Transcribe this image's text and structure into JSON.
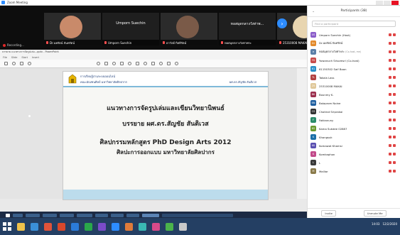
{
  "window": {
    "title": "Zoom Meeting"
  },
  "recording": {
    "label": "Recording..."
  },
  "video_tiles": [
    {
      "name": "Dr.นพรัตน์ จันทรัตน์",
      "kind": "video",
      "face_color": "#c98a6a"
    },
    {
      "name": "Umporn Suechin",
      "kind": "name",
      "display": "Umporn Suechin"
    },
    {
      "name": "ดาวัลย์ กิตติรัตน์",
      "kind": "video",
      "face_color": "#7a5a48"
    },
    {
      "name": "หอสมุดกลางวังท่าพระ",
      "kind": "name",
      "display": "หอสมุดกลางวังท่าพ..."
    },
    {
      "name": "25310008 MAKAI",
      "kind": "video",
      "face_color": "#e8d5b0"
    }
  ],
  "ppt": {
    "title": "บรรยาย แนวทางการจัดรูปเล่ม...pptx - PowerPoint",
    "tabs": [
      "File",
      "Slide",
      "Start",
      "Insert"
    ],
    "slide": {
      "header_line1": "การเรียนรู้ผ่านระบบออนไลน์",
      "header_line2": "คณะมัณฑนศิลป์ มหาวิทยาลัยศิลปากร",
      "header_right": "ผศ.ดร.สัญชัย สันติเวส",
      "lines": [
        "แนวทางการจัดรูปเล่มและเขียนวิทยานิพนธ์",
        "บรรยาย ผศ.ดร.สัญชัย สันติเวส",
        "ศิลปกรรมหลักสูตร PhD Design Arts 2012",
        "ศิลปะการออกแบบ มหาวิทยาลัยศิลปากร"
      ]
    }
  },
  "participants": {
    "title": "Participants (38)",
    "search_placeholder": "Find a participant",
    "list": [
      {
        "name": "Umporn Suechin (Host)",
        "tag": "",
        "color": "#8a5cc9",
        "initials": "US"
      },
      {
        "name": "Dr.นพรัตน์ จันทรัตน์",
        "tag": "",
        "color": "#e38a2b",
        "initials": "Dr"
      },
      {
        "name": "หอสมุดกลางวังท่าพระ",
        "tag": "(Co-host, me)",
        "color": "#5b7fa8",
        "initials": "ห"
      },
      {
        "name": "Yuwanuch Srisomsri (Co-host)",
        "tag": "",
        "color": "#c74b4b",
        "initials": "YS"
      },
      {
        "name": "61150302 Saif Boon",
        "tag": "",
        "color": "#2a8fc9",
        "initials": "61"
      },
      {
        "name": "Takala Lass",
        "tag": "",
        "color": "#b24141",
        "initials": "TL"
      },
      {
        "name": "25310008 MAKAI",
        "tag": "",
        "color": "#e0c89a",
        "initials": "25"
      },
      {
        "name": "Bounmy K.",
        "tag": "",
        "color": "#9b2f4d",
        "initials": "BK"
      },
      {
        "name": "Balaprom Noine",
        "tag": "",
        "color": "#1f5fa0",
        "initials": "BN"
      },
      {
        "name": "Chotirot Sriprakai",
        "tag": "",
        "color": "#333333",
        "initials": "CS"
      },
      {
        "name": "Fakkanuny",
        "tag": "",
        "color": "#2b8c6a",
        "initials": "F"
      },
      {
        "name": "Kama Sukdee 02887",
        "tag": "",
        "color": "#6a9a2f",
        "initials": "KS"
      },
      {
        "name": "Khongsuk",
        "tag": "",
        "color": "#1c6fa8",
        "initials": "K"
      },
      {
        "name": "Komawat Khamsi",
        "tag": "",
        "color": "#5a4fb0",
        "initials": "KK"
      },
      {
        "name": "Komkaphon",
        "tag": "",
        "color": "#c24a8a",
        "initials": "K"
      },
      {
        "name": "L",
        "tag": "",
        "color": "#3a3a3a",
        "initials": "L"
      },
      {
        "name": "Malliar",
        "tag": "",
        "color": "#8a7a4a",
        "initials": "M"
      }
    ],
    "footer": {
      "invite": "Invite",
      "unmute_me": "Unmute Me"
    }
  },
  "taskbar": {
    "time": "14:03",
    "date": "12/2/2020"
  }
}
